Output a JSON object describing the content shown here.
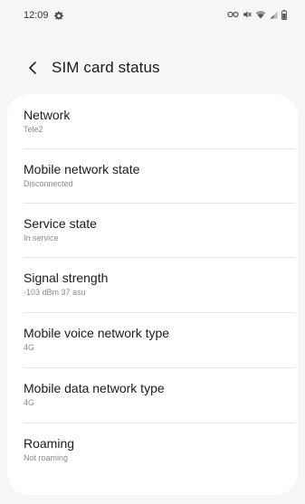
{
  "status_bar": {
    "time": "12:09",
    "icons": [
      "app-notification-icon",
      "vpn-key-icon",
      "mute-icon",
      "wifi-icon",
      "signal-icon",
      "battery-icon"
    ]
  },
  "header": {
    "title": "SIM card status"
  },
  "items": [
    {
      "title": "Network",
      "value": "Tele2"
    },
    {
      "title": "Mobile network state",
      "value": "Disconnected"
    },
    {
      "title": "Service state",
      "value": "In service"
    },
    {
      "title": "Signal strength",
      "value": "-103 dBm 37 asu"
    },
    {
      "title": "Mobile voice network type",
      "value": "4G"
    },
    {
      "title": "Mobile data network type",
      "value": "4G"
    },
    {
      "title": "Roaming",
      "value": "Not roaming"
    }
  ],
  "colors": {
    "background": "#f6f6f6",
    "card": "#ffffff",
    "title_text": "#1b1b1b",
    "secondary_text": "#8a8a8a",
    "divider": "#e6e6e6"
  }
}
